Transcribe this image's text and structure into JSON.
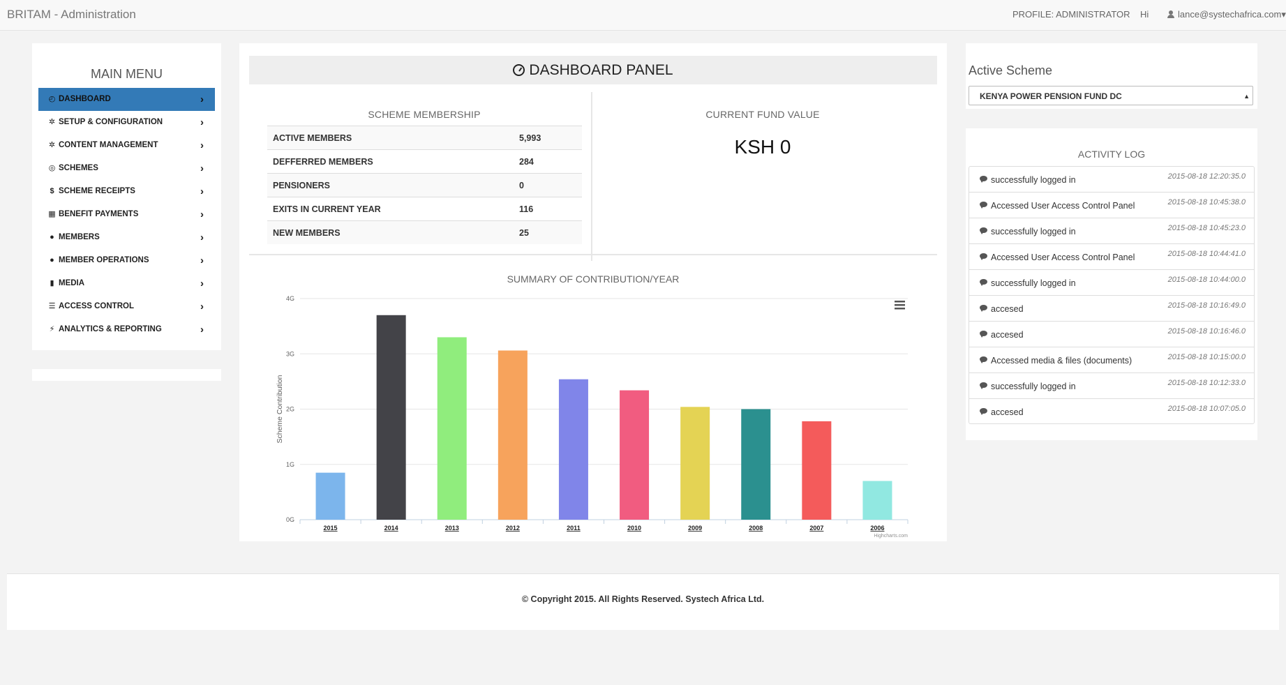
{
  "navbar": {
    "brand": "BRITAM - Administration",
    "profile": "PROFILE: ADMINISTRATOR",
    "greeting": "Hi",
    "user_email": "lance@systechafrica.com",
    "user_caret": "▾"
  },
  "menu": {
    "title": "MAIN MENU",
    "items": [
      {
        "label": "DASHBOARD",
        "icon": "dashboard-icon",
        "glyph": "◴",
        "active": true
      },
      {
        "label": "SETUP & CONFIGURATION",
        "icon": "gear-icon",
        "glyph": "✲",
        "active": false
      },
      {
        "label": "CONTENT MANAGEMENT",
        "icon": "gear-icon",
        "glyph": "✲",
        "active": false
      },
      {
        "label": "SCHEMES",
        "icon": "circle-icon",
        "glyph": "◎",
        "active": false
      },
      {
        "label": "SCHEME RECEIPTS",
        "icon": "dollar-icon",
        "glyph": "$",
        "active": false
      },
      {
        "label": "BENEFIT PAYMENTS",
        "icon": "gift-icon",
        "glyph": "▦",
        "active": false
      },
      {
        "label": "MEMBERS",
        "icon": "user-icon",
        "glyph": "●",
        "active": false
      },
      {
        "label": "MEMBER OPERATIONS",
        "icon": "user-icon",
        "glyph": "●",
        "active": false
      },
      {
        "label": "MEDIA",
        "icon": "bookmark-icon",
        "glyph": "▮",
        "active": false
      },
      {
        "label": "ACCESS CONTROL",
        "icon": "server-icon",
        "glyph": "☰",
        "active": false
      },
      {
        "label": "ANALYTICS & REPORTING",
        "icon": "flash-icon",
        "glyph": "⚡",
        "active": false
      }
    ],
    "chevron": "›"
  },
  "dashboard": {
    "title": "DASHBOARD PANEL",
    "membership_title": "SCHEME MEMBERSHIP",
    "membership": [
      {
        "label": "ACTIVE MEMBERS",
        "value": "5,993"
      },
      {
        "label": "DEFFERRED MEMBERS",
        "value": "284"
      },
      {
        "label": "PENSIONERS",
        "value": "0"
      },
      {
        "label": "EXITS IN CURRENT YEAR",
        "value": "116"
      },
      {
        "label": "NEW MEMBERS",
        "value": "25"
      }
    ],
    "fund_title": "CURRENT FUND VALUE",
    "fund_value": "KSH 0",
    "chart_title": "SUMMARY OF CONTRIBUTION/YEAR"
  },
  "chart_data": {
    "type": "bar",
    "title": "SUMMARY OF CONTRIBUTION/YEAR",
    "xlabel": "",
    "ylabel": "Scheme Contribution",
    "categories": [
      "2015",
      "2014",
      "2013",
      "2012",
      "2011",
      "2010",
      "2009",
      "2008",
      "2007",
      "2006"
    ],
    "values": [
      0.85,
      3.7,
      3.3,
      3.06,
      2.54,
      2.34,
      2.04,
      2.0,
      1.78,
      0.7
    ],
    "colors": [
      "#7cb5ec",
      "#434348",
      "#90ed7d",
      "#f7a35c",
      "#8085e9",
      "#f15c80",
      "#e4d354",
      "#2b908f",
      "#f45b5b",
      "#91e8e1"
    ],
    "y_ticks": [
      "0G",
      "1G",
      "2G",
      "3G",
      "4G"
    ],
    "ylim": [
      0,
      4
    ],
    "grid": true,
    "legend": "none",
    "credits": "Highcharts.com",
    "menu_icon": "hamburger-icon"
  },
  "scheme": {
    "label": "Active Scheme",
    "selected": "KENYA POWER PENSION FUND DC"
  },
  "activity_log": {
    "title": "ACTIVITY LOG",
    "entries": [
      {
        "message": "successfully logged in",
        "time": "2015-08-18 12:20:35.0"
      },
      {
        "message": "Accessed User Access Control Panel",
        "time": "2015-08-18 10:45:38.0"
      },
      {
        "message": "successfully logged in",
        "time": "2015-08-18 10:45:23.0"
      },
      {
        "message": "Accessed User Access Control Panel",
        "time": "2015-08-18 10:44:41.0"
      },
      {
        "message": "successfully logged in",
        "time": "2015-08-18 10:44:00.0"
      },
      {
        "message": "accesed",
        "time": "2015-08-18 10:16:49.0"
      },
      {
        "message": "accesed",
        "time": "2015-08-18 10:16:46.0"
      },
      {
        "message": "Accessed media & files (documents)",
        "time": "2015-08-18 10:15:00.0"
      },
      {
        "message": "successfully logged in",
        "time": "2015-08-18 10:12:33.0"
      },
      {
        "message": "accesed",
        "time": "2015-08-18 10:07:05.0"
      }
    ]
  },
  "footer": {
    "copyright": "© Copyright 2015. All Rights Reserved. Systech Africa Ltd."
  }
}
